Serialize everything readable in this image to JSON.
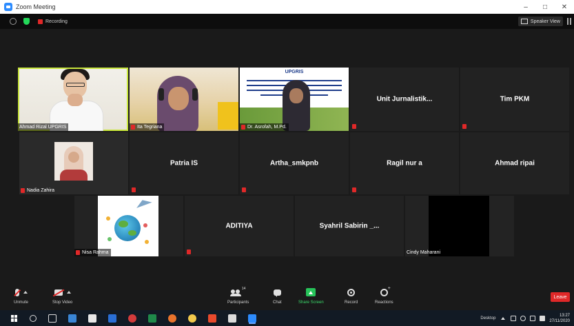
{
  "window": {
    "title": "Zoom Meeting",
    "controls": [
      "–",
      "□",
      "✕"
    ]
  },
  "meeting_bar": {
    "recording_label": "Recording",
    "speaker_view_label": "Speaker View"
  },
  "participants": [
    {
      "name": "Ahmad Rizal UPGRIS",
      "video": true,
      "active": true
    },
    {
      "name": "Ita Tegriana",
      "video": true
    },
    {
      "name": "Dr. Asrofah, M.Pd.",
      "video": true
    },
    {
      "name": "Unit Jurnalistik...",
      "video": false
    },
    {
      "name": "Tim PKM",
      "video": false
    },
    {
      "name": "Nadia Zahira",
      "video": true
    },
    {
      "name": "Patria IS",
      "video": false
    },
    {
      "name": "Artha_smkpnb",
      "video": false
    },
    {
      "name": "Ragil nur a",
      "video": false
    },
    {
      "name": "Ahmad ripai",
      "video": false
    },
    {
      "name": "Nisa Rahma",
      "video": true
    },
    {
      "name": "ADITIYA",
      "video": false
    },
    {
      "name": "Syahril Sabirin _...",
      "video": false
    },
    {
      "name": "Cindy Maharani",
      "video": true
    }
  ],
  "banner": {
    "logo_text": "UPGRIS"
  },
  "toolbar": {
    "unmute": "Unmute",
    "stop_video": "Stop Video",
    "participants": "Participants",
    "participants_count": "14",
    "chat": "Chat",
    "share_screen": "Share Screen",
    "record": "Record",
    "reactions": "Reactions",
    "leave": "Leave"
  },
  "taskbar": {
    "desktop_label": "Desktop",
    "time": "13:27",
    "date": "27/11/2020"
  },
  "colors": {
    "active_speaker": "#c9e63c",
    "mic_off": "#e02828",
    "share_green": "#27c45a",
    "zoom_blue": "#2d8cff"
  }
}
